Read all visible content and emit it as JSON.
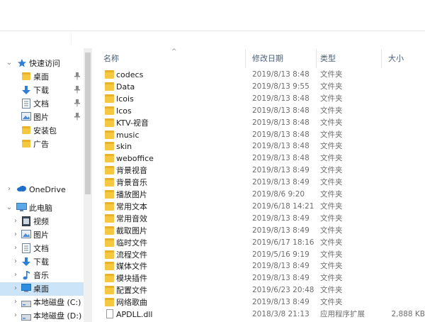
{
  "sidebar": {
    "quick_access": "快速访问",
    "items": [
      {
        "label": "桌面",
        "icon": "desktop-folder-icon",
        "pinned": true
      },
      {
        "label": "下载",
        "icon": "download-arrow-icon",
        "pinned": true
      },
      {
        "label": "文档",
        "icon": "document-icon",
        "pinned": true
      },
      {
        "label": "图片",
        "icon": "pictures-icon",
        "pinned": true
      },
      {
        "label": "安装包",
        "icon": "folder-icon",
        "pinned": false
      },
      {
        "label": "广告",
        "icon": "folder-icon",
        "pinned": false
      }
    ],
    "onedrive": "OneDrive",
    "this_pc": "此电脑",
    "pc_items": [
      {
        "label": "视频",
        "icon": "video-icon"
      },
      {
        "label": "图片",
        "icon": "pictures-icon"
      },
      {
        "label": "文档",
        "icon": "document-icon"
      },
      {
        "label": "下载",
        "icon": "download-arrow-icon"
      },
      {
        "label": "音乐",
        "icon": "music-note-icon"
      },
      {
        "label": "桌面",
        "icon": "desktop-icon",
        "selected": true
      },
      {
        "label": "本地磁盘 (C:)",
        "icon": "drive-icon"
      },
      {
        "label": "本地磁盘 (D:)",
        "icon": "drive-icon"
      }
    ],
    "pin_glyph": "📌"
  },
  "columns": {
    "name": "名称",
    "modified": "修改日期",
    "type": "类型",
    "size": "大小"
  },
  "files": [
    {
      "name": "codecs",
      "modified": "2019/8/13 8:48",
      "type": "文件夹",
      "size": "",
      "kind": "folder"
    },
    {
      "name": "Data",
      "modified": "2019/8/13 9:55",
      "type": "文件夹",
      "size": "",
      "kind": "folder"
    },
    {
      "name": "Icois",
      "modified": "2019/8/13 8:48",
      "type": "文件夹",
      "size": "",
      "kind": "folder"
    },
    {
      "name": "Icos",
      "modified": "2019/8/13 8:48",
      "type": "文件夹",
      "size": "",
      "kind": "folder"
    },
    {
      "name": "KTV-视音",
      "modified": "2019/8/13 8:48",
      "type": "文件夹",
      "size": "",
      "kind": "folder"
    },
    {
      "name": "music",
      "modified": "2019/8/13 8:48",
      "type": "文件夹",
      "size": "",
      "kind": "folder"
    },
    {
      "name": "skin",
      "modified": "2019/8/13 8:48",
      "type": "文件夹",
      "size": "",
      "kind": "folder"
    },
    {
      "name": "weboffice",
      "modified": "2019/8/13 8:48",
      "type": "文件夹",
      "size": "",
      "kind": "folder"
    },
    {
      "name": "背景视音",
      "modified": "2019/8/13 8:49",
      "type": "文件夹",
      "size": "",
      "kind": "folder"
    },
    {
      "name": "背景音乐",
      "modified": "2019/8/13 8:49",
      "type": "文件夹",
      "size": "",
      "kind": "folder"
    },
    {
      "name": "播放图片",
      "modified": "2019/8/6 9:20",
      "type": "文件夹",
      "size": "",
      "kind": "folder"
    },
    {
      "name": "常用文本",
      "modified": "2019/6/18 14:21",
      "type": "文件夹",
      "size": "",
      "kind": "folder"
    },
    {
      "name": "常用音效",
      "modified": "2019/8/13 8:49",
      "type": "文件夹",
      "size": "",
      "kind": "folder"
    },
    {
      "name": "截取图片",
      "modified": "2019/8/13 8:49",
      "type": "文件夹",
      "size": "",
      "kind": "folder"
    },
    {
      "name": "临时文件",
      "modified": "2019/6/17 18:16",
      "type": "文件夹",
      "size": "",
      "kind": "folder"
    },
    {
      "name": "流程文件",
      "modified": "2019/5/16 9:19",
      "type": "文件夹",
      "size": "",
      "kind": "folder"
    },
    {
      "name": "媒体文件",
      "modified": "2019/8/13 8:49",
      "type": "文件夹",
      "size": "",
      "kind": "folder"
    },
    {
      "name": "模块插件",
      "modified": "2019/8/13 8:49",
      "type": "文件夹",
      "size": "",
      "kind": "folder"
    },
    {
      "name": "配置文件",
      "modified": "2019/6/23 20:48",
      "type": "文件夹",
      "size": "",
      "kind": "folder"
    },
    {
      "name": "网络歌曲",
      "modified": "2019/8/13 8:49",
      "type": "文件夹",
      "size": "",
      "kind": "folder"
    },
    {
      "name": "APDLL.dll",
      "modified": "2018/3/8 21:13",
      "type": "应用程序扩展",
      "size": "2,888 KB",
      "kind": "file"
    }
  ],
  "colors": {
    "selected_bg": "#cce4f7",
    "folder": "#f5c842",
    "header_text": "#4c607a",
    "muted_text": "#6d6d6d"
  }
}
